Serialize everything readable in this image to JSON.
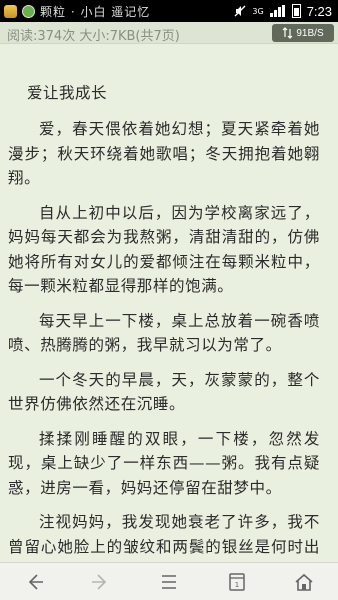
{
  "statusbar": {
    "title": "颗粒 · 小白 遥记忆",
    "time": "7:23",
    "network": "3G"
  },
  "infobar": {
    "stats": "阅读:374次 大小:7KB(共7页)",
    "speed": "91B/S"
  },
  "article": {
    "title": "爱让我成长",
    "paragraphs": [
      "爱，春天偎依着她幻想；夏天紧牵着她漫步；秋天环绕着她歌唱；冬天拥抱着她翱翔。",
      "自从上初中以后，因为学校离家远了，妈妈每天都会为我熬粥，清甜清甜的，仿佛她将所有对女儿的爱都倾注在每颗米粒中，每一颗米粒都显得那样的饱满。",
      "每天早上一下楼，桌上总放着一碗香喷喷、热腾腾的粥，我早就习以为常了。",
      "一个冬天的早晨，天，灰蒙蒙的，整个世界仿佛依然还在沉睡。",
      "揉揉刚睡醒的双眼，一下楼，忽然发现，桌上缺少了一样东西——粥。我有点疑惑，进房一看，妈妈还停留在甜梦中。",
      "注视妈妈，我发现她衰老了许多，我不曾留心她脸上的皱纹和两鬓的银丝是何时出现"
    ]
  },
  "bottomnav": [
    {
      "name": "back-icon"
    },
    {
      "name": "forward-icon"
    },
    {
      "name": "menu-icon"
    },
    {
      "name": "tabs-icon"
    },
    {
      "name": "home-icon"
    }
  ]
}
